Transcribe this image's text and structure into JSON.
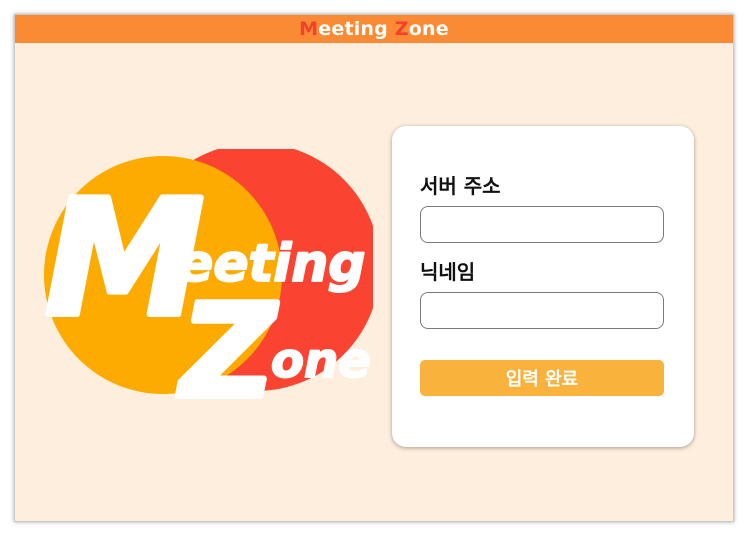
{
  "window": {
    "title_parts": [
      "M",
      "eeting ",
      "Z",
      "one"
    ]
  },
  "logo": {
    "line1_initial": "M",
    "line1_rest": "eeting",
    "line2_initial": "Z",
    "line2_rest": "one"
  },
  "form": {
    "server_address_label": "서버 주소",
    "server_address_value": "",
    "nickname_label": "닉네임",
    "nickname_value": "",
    "submit_label": "입력 완료"
  },
  "colors": {
    "background": "#fdeedd",
    "title_bar": "#fb8a35",
    "title_accent": "#f2412d",
    "logo_yellow": "#fdab00",
    "logo_red": "#fa4331",
    "button": "#f9b33d"
  }
}
